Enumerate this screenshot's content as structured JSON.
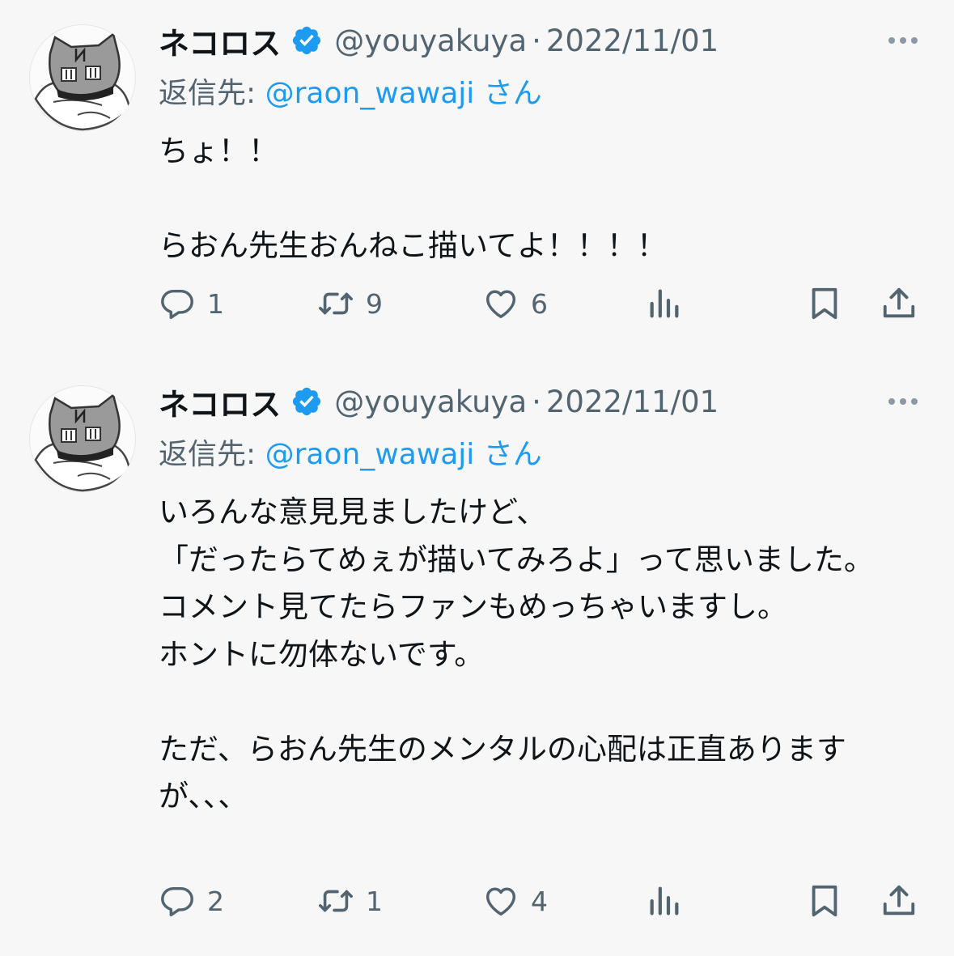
{
  "tweets": [
    {
      "author_name": "ネコロス",
      "handle": "@youyakuya",
      "separator": "·",
      "date": "2022/11/01",
      "reply_label": "返信先: ",
      "reply_handle": "@raon_wawaji",
      "reply_suffix": " さん",
      "text": "ちょ！！\n\nらおん先生おんねこ描いてよ！！！！",
      "replies": "1",
      "retweets": "9",
      "likes": "6"
    },
    {
      "author_name": "ネコロス",
      "handle": "@youyakuya",
      "separator": "·",
      "date": "2022/11/01",
      "reply_label": "返信先: ",
      "reply_handle": "@raon_wawaji",
      "reply_suffix": " さん",
      "text": "いろんな意見見ましたけど、\n「だったらてめぇが描いてみろよ」って思いました。\nコメント見てたらファンもめっちゃいますし。\nホントに勿体ないです。\n\nただ、らおん先生のメンタルの心配は正直ありますが、、、",
      "replies": "2",
      "retweets": "1",
      "likes": "4"
    }
  ],
  "icons": {
    "verified": "verified-badge-icon",
    "more": "more-dots-icon",
    "reply": "reply-bubble-icon",
    "retweet": "retweet-arrows-icon",
    "like": "heart-icon",
    "views": "bar-chart-icon",
    "bookmark": "bookmark-icon",
    "share": "share-upload-icon"
  },
  "colors": {
    "background": "#f7f7f7",
    "text": "#0f1419",
    "secondary": "#536471",
    "link": "#1d9bf0",
    "verified": "#1d9bf0"
  }
}
